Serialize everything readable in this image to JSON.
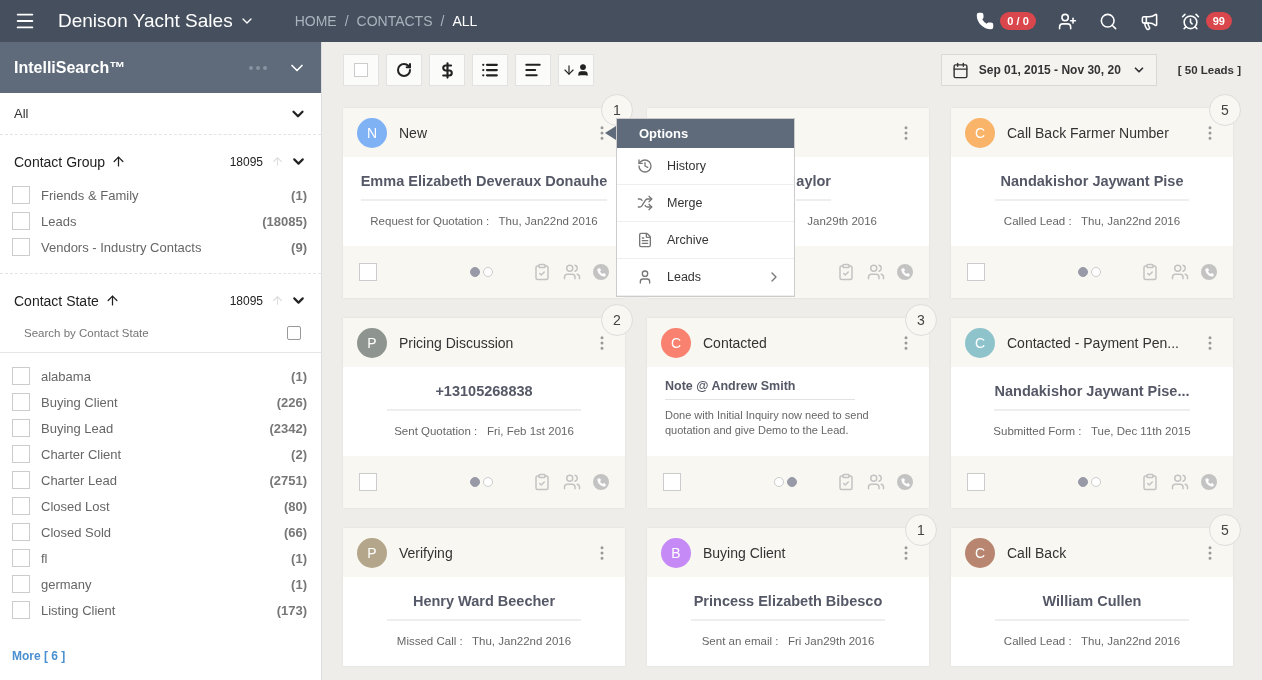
{
  "topbar": {
    "app_title": "Denison Yacht Sales",
    "breadcrumb": [
      {
        "label": "HOME",
        "selected": false
      },
      {
        "label": "CONTACTS",
        "selected": false
      },
      {
        "label": "ALL",
        "selected": true
      }
    ],
    "breadcrumb_separators": [
      "/",
      "/"
    ],
    "call_badge": "0 / 0",
    "alarm_badge": "99"
  },
  "sidebar": {
    "title": "IntelliSearch™",
    "filter": "All",
    "groups": [
      {
        "title": "Contact Group",
        "total": "18095",
        "items": [
          {
            "label": "Friends & Family",
            "count": "(1)",
            "checked": false
          },
          {
            "label": "Leads",
            "count": "(18085)",
            "checked": false
          },
          {
            "label": "Vendors - Industry Contacts",
            "count": "(9)",
            "checked": false
          }
        ]
      },
      {
        "title": "Contact State",
        "total": "18095",
        "search_placeholder": "Search by Contact State",
        "select_all_checked": false,
        "items": [
          {
            "label": "alabama",
            "count": "(1)",
            "checked": false
          },
          {
            "label": "Buying Client",
            "count": "(226)",
            "checked": false
          },
          {
            "label": "Buying Lead",
            "count": "(2342)",
            "checked": false
          },
          {
            "label": "Charter Client",
            "count": "(2)",
            "checked": false
          },
          {
            "label": "Charter Lead",
            "count": "(2751)",
            "checked": false
          },
          {
            "label": "Closed Lost",
            "count": "(80)",
            "checked": false
          },
          {
            "label": "Closed Sold",
            "count": "(66)",
            "checked": false
          },
          {
            "label": "fl",
            "count": "(1)",
            "checked": false
          },
          {
            "label": "germany",
            "count": "(1)",
            "checked": false
          },
          {
            "label": "Listing Client",
            "count": "(173)",
            "checked": false
          }
        ]
      }
    ],
    "more_link": "More [ 6 ]"
  },
  "toolbar": {
    "date_range": "Sep 01, 2015 - Nov 30, 20",
    "lead_count": "[ 50 Leads ]"
  },
  "cards": [
    {
      "kind": "contact",
      "initial": "N",
      "color": "#7fb1f5",
      "status": "New",
      "badge": "1",
      "name": "Emma Elizabeth Deveraux Donauhe",
      "activity": "Request for Quotation :",
      "date": "Thu, Jan22nd 2016",
      "checked": false,
      "dots": [
        {
          "selected": true
        },
        {
          "selected": false
        }
      ]
    },
    {
      "kind": "covered",
      "name": "aylor",
      "date": "Jan29th 2016"
    },
    {
      "kind": "contact",
      "initial": "C",
      "color": "#f9b46a",
      "status": "Call Back Farmer Number",
      "badge": "5",
      "name": "Nandakishor Jaywant Pise",
      "activity": "Called Lead :",
      "date": "Thu, Jan22nd 2016",
      "checked": false,
      "dots": [
        {
          "selected": true
        },
        {
          "selected": false
        }
      ]
    },
    {
      "kind": "contact",
      "initial": "P",
      "color": "#8e948f",
      "status": "Pricing Discussion",
      "badge": "2",
      "name": "+13105268838",
      "activity": "Sent Quotation :",
      "date": "Fri, Feb 1st 2016",
      "checked": false,
      "dots": [
        {
          "selected": true
        },
        {
          "selected": false
        }
      ]
    },
    {
      "kind": "note",
      "initial": "C",
      "color": "#f8816f",
      "status": "Contacted",
      "badge": "3",
      "name": "Note @ Andrew Smith",
      "note": "Done with Initial Inquiry now need to send quotation and give Demo to the Lead.",
      "checked": false,
      "dots": [
        {
          "selected": false
        },
        {
          "selected": true
        }
      ]
    },
    {
      "kind": "contact",
      "initial": "C",
      "color": "#8fc3cc",
      "status": "Contacted - Payment Pen...",
      "name": "Nandakishor Jaywant Pise...",
      "activity": "Submitted Form :",
      "date": "Tue, Dec 11th 2015",
      "checked": false,
      "dots": [
        {
          "selected": true
        },
        {
          "selected": false
        }
      ]
    },
    {
      "kind": "contact",
      "initial": "P",
      "color": "#b4a68a",
      "status": "Verifying",
      "name": "Henry Ward Beecher",
      "activity": "Missed Call :",
      "date": "Thu, Jan22nd 2016"
    },
    {
      "kind": "contact",
      "initial": "B",
      "color": "#c58af5",
      "status": "Buying Client",
      "badge": "1",
      "name": "Princess Elizabeth Bibesco",
      "activity": "Sent an email :",
      "date": "Fri Jan29th 2016"
    },
    {
      "kind": "contact",
      "initial": "C",
      "color": "#b88670",
      "status": "Call Back",
      "badge": "5",
      "name": "William Cullen",
      "activity": "Called Lead :",
      "date": "Thu, Jan22nd 2016"
    }
  ],
  "options_menu": {
    "title": "Options",
    "items": [
      {
        "label": "History",
        "has_submenu": false
      },
      {
        "label": "Merge",
        "has_submenu": false
      },
      {
        "label": "Archive",
        "has_submenu": false
      },
      {
        "label": "Leads",
        "has_submenu": true
      }
    ]
  }
}
